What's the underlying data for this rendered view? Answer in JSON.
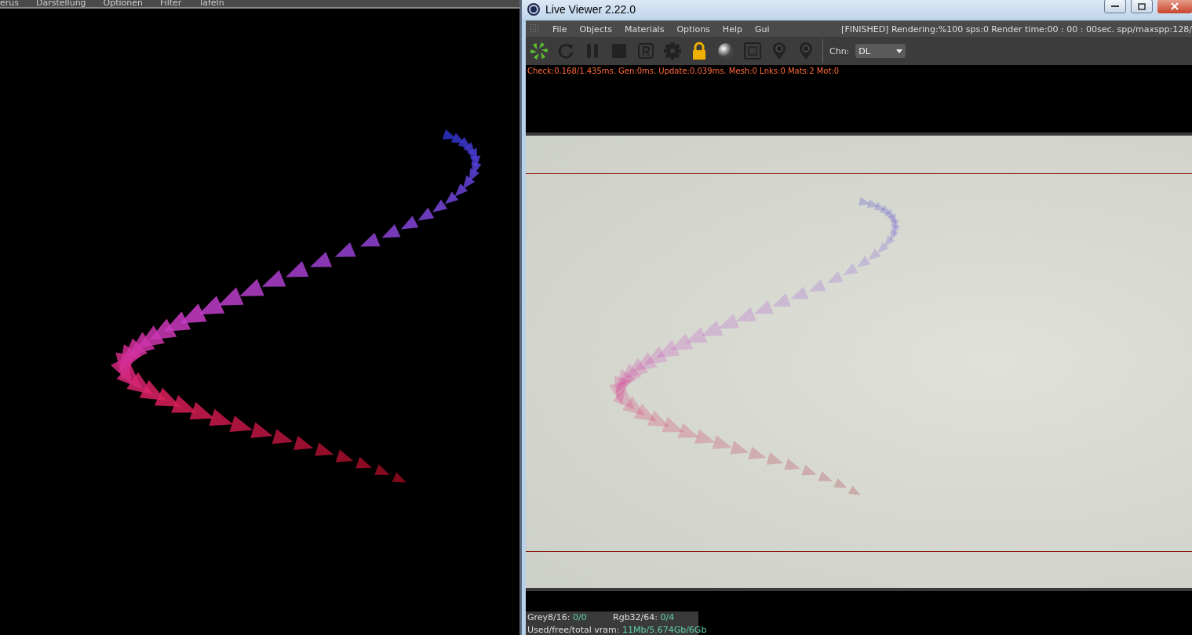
{
  "left_viewport": {
    "menu": [
      "erus",
      "Darstellung",
      "Optionen",
      "Filter",
      "Tafeln"
    ]
  },
  "window": {
    "title": "Live Viewer 2.22.0"
  },
  "menu": [
    "File",
    "Objects",
    "Materials",
    "Options",
    "Help",
    "Gui"
  ],
  "render_status": "[FINISHED]  Rendering:%100 sps:0 Render time:00 : 00 : 00sec. spp/maxspp:128/",
  "channel": {
    "label": "Chn:",
    "value": "DL"
  },
  "stats_line": "Check:0.168/1.435ms. Gen:0ms. Update:0.039ms. Mesh:0 Lnks:0 Mats:2 Mot:0",
  "memory": [
    {
      "label": "Grey8/16:",
      "value": "0/0"
    },
    {
      "label": "Rgb32/64:",
      "value": "0/4"
    }
  ],
  "vram": {
    "label": "Used/free/total vram:",
    "value": "11Mb/5.674Gb/6Gb"
  }
}
